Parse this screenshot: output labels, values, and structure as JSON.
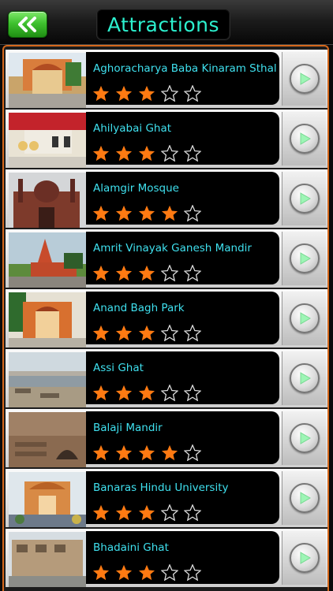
{
  "header": {
    "title": "Attractions",
    "back_icon": "double-chevron-left-icon",
    "back_color": "#3fc12f"
  },
  "colors": {
    "title": "#2cf0ce",
    "name": "#3fe0ee",
    "star_filled": "#ff7a12",
    "frame": "#d5681c"
  },
  "attractions": [
    {
      "name": "Aghoracharya Baba Kinaram Sthal",
      "rating": 3
    },
    {
      "name": "Ahilyabai Ghat",
      "rating": 3
    },
    {
      "name": "Alamgir Mosque",
      "rating": 4
    },
    {
      "name": "Amrit Vinayak Ganesh Mandir",
      "rating": 3
    },
    {
      "name": "Anand Bagh Park",
      "rating": 3
    },
    {
      "name": "Assi Ghat",
      "rating": 3
    },
    {
      "name": "Balaji Mandir",
      "rating": 4
    },
    {
      "name": "Banaras Hindu University",
      "rating": 3
    },
    {
      "name": "Bhadaini Ghat",
      "rating": 3
    }
  ],
  "max_rating": 5,
  "row_action_icon": "play-arrow-icon"
}
